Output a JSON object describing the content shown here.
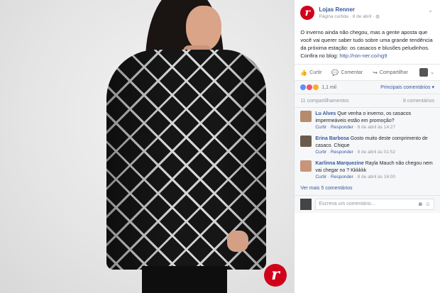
{
  "post": {
    "page_name": "Lojas Renner",
    "logo_letter": "r",
    "meta_type": "Página curtida",
    "meta_sep": "·",
    "meta_date": "8 de abril",
    "meta_globe": "◍",
    "text": "O inverno ainda não chegou, mas a gente aposta que você vai querer saber tudo sobre uma grande tendência da próxima estação: os casacos e blusões peludinhos. Confira no blog: ",
    "link": "http://ron-ner.co/ng9",
    "chevron": "⌄"
  },
  "actions": {
    "like": "Curtir",
    "comment": "Comentar",
    "share": "Compartilhar",
    "like_icon": "👍",
    "comment_icon": "💬",
    "share_icon": "↪"
  },
  "reactions": {
    "count": "1,1 mil",
    "relevant": "Principais comentários ▾"
  },
  "shares": {
    "count": "11 compartilhamentos",
    "comments": "8 comentários"
  },
  "comments": [
    {
      "name": "Lu Alves",
      "text": "Que venha o inverno, os casacos impermeáveis estão em promoção?",
      "like": "Curtir",
      "reply": "Responder",
      "date": "8 de abril às 14:27"
    },
    {
      "name": "Erina Barbosa",
      "text": "Gosto muito deste comprimento de casaco. Chique",
      "like": "Curtir",
      "reply": "Responder",
      "date": "8 de abril às 01:52"
    },
    {
      "name": "Karlinna Marquezine",
      "text": "Rayla Mauch não chegou nem vai chegar no ? Kkkkkk",
      "like": "Curtir",
      "reply": "Responder",
      "date": "8 de abril às 16:00"
    }
  ],
  "more_comments": "Ver mais 5 comentários",
  "write": {
    "placeholder": "Escreva um comentário...",
    "camera_icon": "◙",
    "emoji_icon": "☺"
  },
  "meta_sep_dot": "·",
  "colors": {
    "brand_red": "#d0021b",
    "link_blue": "#365899"
  }
}
